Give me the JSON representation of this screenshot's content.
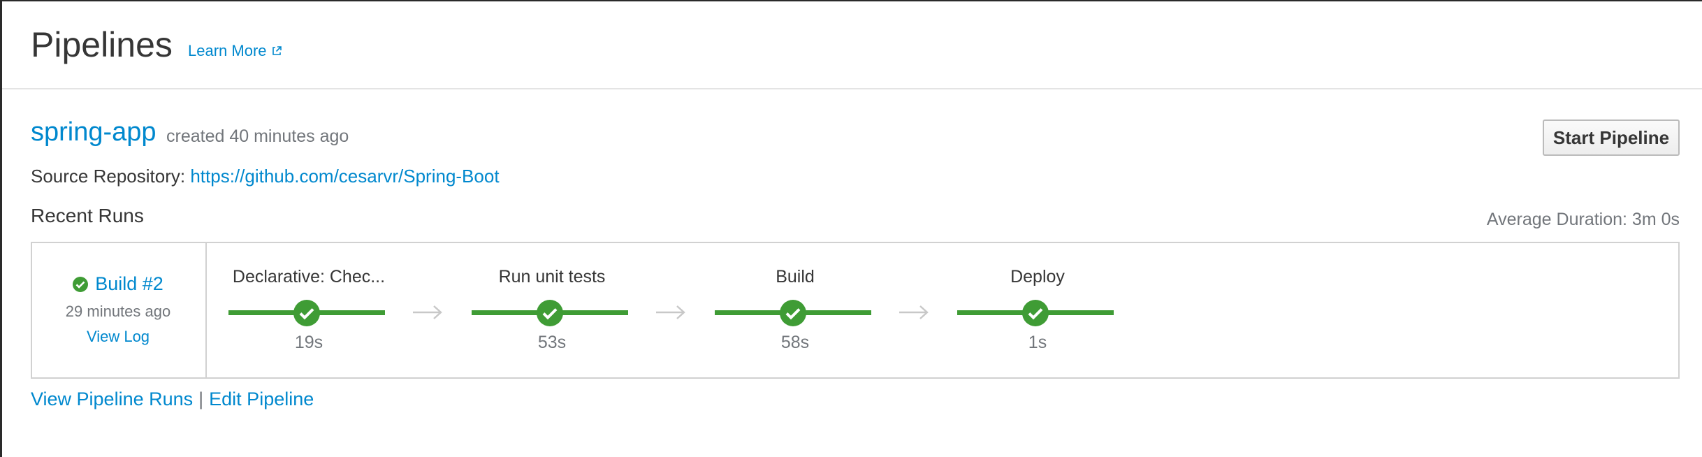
{
  "header": {
    "title": "Pipelines",
    "learn_more": "Learn More"
  },
  "pipeline": {
    "name": "spring-app",
    "created": "created 40 minutes ago",
    "start_button": "Start Pipeline",
    "source_label": "Source Repository:",
    "source_url": "https://github.com/cesarvr/Spring-Boot"
  },
  "runs": {
    "heading": "Recent Runs",
    "average_duration": "Average Duration: 3m 0s",
    "latest": {
      "build": "Build #2",
      "time": "29 minutes ago",
      "view_log": "View Log",
      "status": "success"
    },
    "stages": [
      {
        "name": "Declarative: Chec...",
        "duration": "19s",
        "status": "success"
      },
      {
        "name": "Run unit tests",
        "duration": "53s",
        "status": "success"
      },
      {
        "name": "Build",
        "duration": "58s",
        "status": "success"
      },
      {
        "name": "Deploy",
        "duration": "1s",
        "status": "success"
      }
    ]
  },
  "footer": {
    "view_runs": "View Pipeline Runs",
    "separator": "|",
    "edit": "Edit Pipeline"
  },
  "colors": {
    "link": "#0088ce",
    "success": "#3f9c35",
    "muted": "#72767b",
    "text": "#363636",
    "arrow": "#c8c8c8"
  },
  "icons": {
    "external": "external-link-icon",
    "success": "check-circle-icon",
    "arrow": "arrow-right-icon"
  }
}
